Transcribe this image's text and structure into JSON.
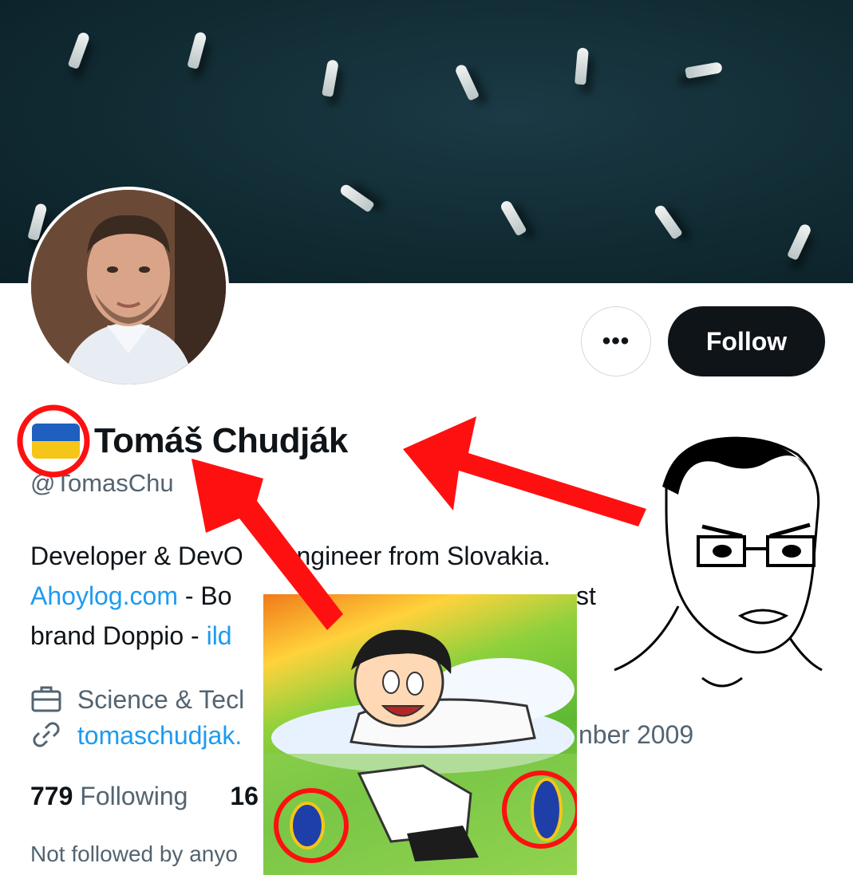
{
  "profile": {
    "display_name": "Tomáš Chudják",
    "handle": "@TomasChu",
    "bio_line1_a": "Developer & DevO",
    "bio_line1_b": " engineer from Slovakia.",
    "bio_line2_link": "Ahoylog.com",
    "bio_line2_b": " - Bo",
    "bio_line2_c": "st",
    "bio_line3_a": "brand Doppio - ",
    "bio_line3_link": "ild",
    "category": "Science & Tecl",
    "website": "tomaschudjak.",
    "joined": "nber 2009",
    "following_count": "779",
    "following_label": "Following",
    "followers_count_partial": "16",
    "not_followed": "Not followed by anyo"
  },
  "actions": {
    "more_label": "•••",
    "follow_label": "Follow"
  },
  "icons": {
    "category": "briefcase-icon",
    "website": "link-icon",
    "more": "more-icon"
  },
  "colors": {
    "accent": "#1d9bf0",
    "text_primary": "#0f1419",
    "text_secondary": "#536471",
    "annotation_red": "#ff1010",
    "flag_blue": "#1f5fbf",
    "flag_yellow": "#f5c518"
  }
}
